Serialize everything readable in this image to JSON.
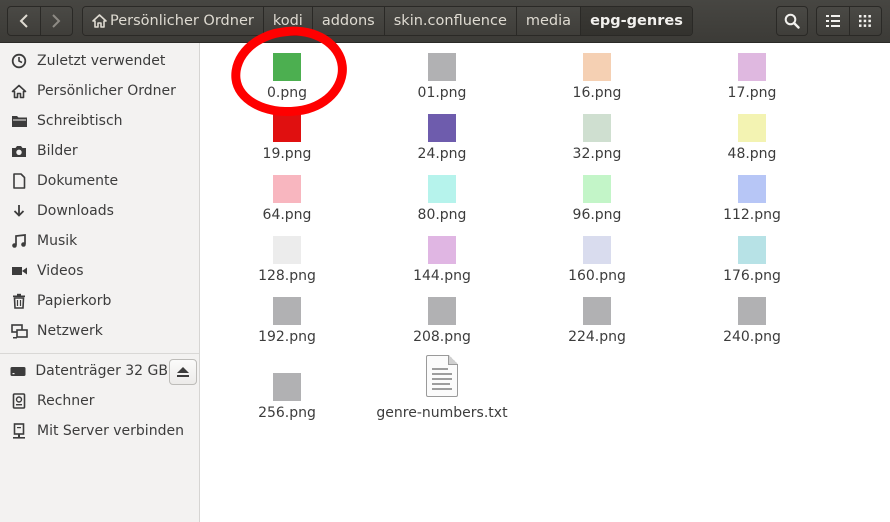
{
  "header": {
    "back_icon": "chevron-left-icon",
    "forward_icon": "chevron-right-icon",
    "breadcrumbs": [
      "Persönlicher Ordner",
      "kodi",
      "addons",
      "skin.confluence",
      "media",
      "epg-genres"
    ],
    "search_icon": "search-icon",
    "list_view_icon": "list-view-icon",
    "grid_view_icon": "grid-view-icon"
  },
  "sidebar": {
    "items": [
      {
        "label": "Zuletzt verwendet",
        "icon": "clock-icon"
      },
      {
        "label": "Persönlicher Ordner",
        "icon": "home-icon"
      },
      {
        "label": "Schreibtisch",
        "icon": "folder-icon"
      },
      {
        "label": "Bilder",
        "icon": "camera-icon"
      },
      {
        "label": "Dokumente",
        "icon": "document-icon"
      },
      {
        "label": "Downloads",
        "icon": "download-icon"
      },
      {
        "label": "Musik",
        "icon": "music-icon"
      },
      {
        "label": "Videos",
        "icon": "video-icon"
      },
      {
        "label": "Papierkorb",
        "icon": "trash-icon"
      },
      {
        "label": "Netzwerk",
        "icon": "network-icon"
      },
      {
        "label": "Datenträger 32 GB",
        "icon": "drive-icon"
      },
      {
        "label": "Rechner",
        "icon": "computer-icon"
      },
      {
        "label": "Mit Server verbinden",
        "icon": "server-icon"
      }
    ]
  },
  "files": [
    {
      "name": "0.png",
      "color": "#4caf50"
    },
    {
      "name": "01.png",
      "color": "#b1b1b3"
    },
    {
      "name": "16.png",
      "color": "#f5d0b3"
    },
    {
      "name": "17.png",
      "color": "#dfb8e0"
    },
    {
      "name": "19.png",
      "color": "#e01010"
    },
    {
      "name": "24.png",
      "color": "#6e5cad"
    },
    {
      "name": "32.png",
      "color": "#cfdfd0"
    },
    {
      "name": "48.png",
      "color": "#f3f3b2"
    },
    {
      "name": "64.png",
      "color": "#f8b6bf"
    },
    {
      "name": "80.png",
      "color": "#b6f3ec"
    },
    {
      "name": "96.png",
      "color": "#c3f5c8"
    },
    {
      "name": "112.png",
      "color": "#b7c6f6"
    },
    {
      "name": "128.png",
      "color": "#ececec"
    },
    {
      "name": "144.png",
      "color": "#e0b6e3"
    },
    {
      "name": "160.png",
      "color": "#d9dcee"
    },
    {
      "name": "176.png",
      "color": "#b7e2e6"
    },
    {
      "name": "192.png",
      "color": "#b1b1b3"
    },
    {
      "name": "208.png",
      "color": "#b1b1b3"
    },
    {
      "name": "224.png",
      "color": "#b1b1b3"
    },
    {
      "name": "240.png",
      "color": "#b1b1b3"
    },
    {
      "name": "256.png",
      "color": "#b1b1b3"
    },
    {
      "name": "genre-numbers.txt",
      "icon": "text-file-icon"
    }
  ]
}
